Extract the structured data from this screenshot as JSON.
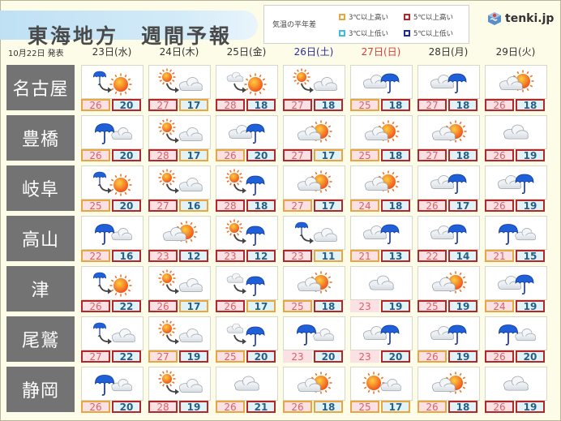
{
  "header": {
    "title": "東海地方　週間予報",
    "issued": "10月22日 発表",
    "logo_text": "tenki.jp"
  },
  "legend": {
    "title": "気温の平年差",
    "items": [
      {
        "label": "3℃以上高い",
        "color": "#e8a640"
      },
      {
        "label": "5℃以上高い",
        "color": "#b3262a"
      },
      {
        "label": "3℃以上低い",
        "color": "#3fbde0"
      },
      {
        "label": "5℃以上低い",
        "color": "#1c2a9c"
      }
    ]
  },
  "days": [
    {
      "label": "23日(水)",
      "type": "weekday"
    },
    {
      "label": "24日(木)",
      "type": "weekday"
    },
    {
      "label": "25日(金)",
      "type": "weekday"
    },
    {
      "label": "26日(土)",
      "type": "sat"
    },
    {
      "label": "27日(日)",
      "type": "sun"
    },
    {
      "label": "28日(月)",
      "type": "weekday"
    },
    {
      "label": "29日(火)",
      "type": "weekday"
    }
  ],
  "colors": {
    "high_3": "#e8a640",
    "high_5": "#b3262a",
    "low_3": "#3fbde0",
    "low_5": "#1c2a9c"
  },
  "cities": [
    {
      "name": "名古屋",
      "forecasts": [
        {
          "weather": "rain>sun",
          "hi": "26",
          "lo": "20",
          "hi_dev": "o",
          "lo_dev": "r"
        },
        {
          "weather": "sun>cloud",
          "hi": "27",
          "lo": "17",
          "hi_dev": "r",
          "lo_dev": "o"
        },
        {
          "weather": "cloud>sun",
          "hi": "28",
          "lo": "18",
          "hi_dev": "r",
          "lo_dev": "r"
        },
        {
          "weather": "sun>cloud",
          "hi": "27",
          "lo": "18",
          "hi_dev": "r",
          "lo_dev": "r"
        },
        {
          "weather": "cloud|rain",
          "hi": "25",
          "lo": "18",
          "hi_dev": "o",
          "lo_dev": "r"
        },
        {
          "weather": "cloud|rain",
          "hi": "27",
          "lo": "18",
          "hi_dev": "r",
          "lo_dev": "r"
        },
        {
          "weather": "cloud|sun",
          "hi": "26",
          "lo": "18",
          "hi_dev": "r",
          "lo_dev": "r"
        }
      ]
    },
    {
      "name": "豊橋",
      "forecasts": [
        {
          "weather": "rain|cloud",
          "hi": "26",
          "lo": "20",
          "hi_dev": "o",
          "lo_dev": "r"
        },
        {
          "weather": "sun>cloud",
          "hi": "28",
          "lo": "17",
          "hi_dev": "r",
          "lo_dev": "o"
        },
        {
          "weather": "cloud|rain",
          "hi": "26",
          "lo": "20",
          "hi_dev": "o",
          "lo_dev": "r"
        },
        {
          "weather": "cloud|sun",
          "hi": "27",
          "lo": "17",
          "hi_dev": "r",
          "lo_dev": "o"
        },
        {
          "weather": "cloud|sun",
          "hi": "25",
          "lo": "18",
          "hi_dev": "o",
          "lo_dev": "r"
        },
        {
          "weather": "cloud|sun",
          "hi": "27",
          "lo": "18",
          "hi_dev": "r",
          "lo_dev": "r"
        },
        {
          "weather": "cloud",
          "hi": "26",
          "lo": "19",
          "hi_dev": "r",
          "lo_dev": "r"
        }
      ]
    },
    {
      "name": "岐阜",
      "forecasts": [
        {
          "weather": "rain>sun",
          "hi": "25",
          "lo": "20",
          "hi_dev": "o",
          "lo_dev": "r"
        },
        {
          "weather": "sun>cloud",
          "hi": "27",
          "lo": "16",
          "hi_dev": "r",
          "lo_dev": "o"
        },
        {
          "weather": "sun>rain",
          "hi": "28",
          "lo": "18",
          "hi_dev": "r",
          "lo_dev": "r"
        },
        {
          "weather": "cloud|sun",
          "hi": "27",
          "lo": "17",
          "hi_dev": "o",
          "lo_dev": "r"
        },
        {
          "weather": "cloud|sun",
          "hi": "24",
          "lo": "18",
          "hi_dev": "o",
          "lo_dev": "r"
        },
        {
          "weather": "cloud|rain",
          "hi": "26",
          "lo": "17",
          "hi_dev": "r",
          "lo_dev": "r"
        },
        {
          "weather": "cloud|rain",
          "hi": "26",
          "lo": "19",
          "hi_dev": "r",
          "lo_dev": "r"
        }
      ]
    },
    {
      "name": "高山",
      "forecasts": [
        {
          "weather": "rain|cloud",
          "hi": "22",
          "lo": "16",
          "hi_dev": "o",
          "lo_dev": "r"
        },
        {
          "weather": "cloud|sun",
          "hi": "23",
          "lo": "12",
          "hi_dev": "r",
          "lo_dev": "r"
        },
        {
          "weather": "sun>rain",
          "hi": "23",
          "lo": "12",
          "hi_dev": "r",
          "lo_dev": "r"
        },
        {
          "weather": "rain>cloud",
          "hi": "23",
          "lo": "11",
          "hi_dev": "r",
          "lo_dev": "o"
        },
        {
          "weather": "cloud|rain",
          "hi": "21",
          "lo": "13",
          "hi_dev": "o",
          "lo_dev": "r"
        },
        {
          "weather": "cloud|rain",
          "hi": "22",
          "lo": "14",
          "hi_dev": "r",
          "lo_dev": "r"
        },
        {
          "weather": "rain|cloud",
          "hi": "21",
          "lo": "15",
          "hi_dev": "o",
          "lo_dev": "r"
        }
      ]
    },
    {
      "name": "津",
      "forecasts": [
        {
          "weather": "rain>sun",
          "hi": "26",
          "lo": "22",
          "hi_dev": "r",
          "lo_dev": "r"
        },
        {
          "weather": "sun>cloud",
          "hi": "26",
          "lo": "17",
          "hi_dev": "r",
          "lo_dev": "o"
        },
        {
          "weather": "cloud>rain",
          "hi": "26",
          "lo": "17",
          "hi_dev": "r",
          "lo_dev": "o"
        },
        {
          "weather": "cloud|sun",
          "hi": "25",
          "lo": "18",
          "hi_dev": "o",
          "lo_dev": "r"
        },
        {
          "weather": "cloud",
          "hi": "23",
          "lo": "19",
          "hi_dev": "n",
          "lo_dev": "r"
        },
        {
          "weather": "cloud|sun",
          "hi": "25",
          "lo": "19",
          "hi_dev": "r",
          "lo_dev": "r"
        },
        {
          "weather": "cloud|rain",
          "hi": "24",
          "lo": "19",
          "hi_dev": "o",
          "lo_dev": "r"
        }
      ]
    },
    {
      "name": "尾鷲",
      "forecasts": [
        {
          "weather": "rain>cloud",
          "hi": "27",
          "lo": "22",
          "hi_dev": "r",
          "lo_dev": "r"
        },
        {
          "weather": "sun>cloud",
          "hi": "27",
          "lo": "19",
          "hi_dev": "o",
          "lo_dev": "r"
        },
        {
          "weather": "cloud>rain",
          "hi": "25",
          "lo": "20",
          "hi_dev": "o",
          "lo_dev": "r"
        },
        {
          "weather": "rain|cloud",
          "hi": "23",
          "lo": "20",
          "hi_dev": "n",
          "lo_dev": "r"
        },
        {
          "weather": "cloud|rain",
          "hi": "23",
          "lo": "20",
          "hi_dev": "n",
          "lo_dev": "r"
        },
        {
          "weather": "cloud|rain",
          "hi": "26",
          "lo": "19",
          "hi_dev": "o",
          "lo_dev": "r"
        },
        {
          "weather": "rain|cloud",
          "hi": "26",
          "lo": "20",
          "hi_dev": "r",
          "lo_dev": "r"
        }
      ]
    },
    {
      "name": "静岡",
      "forecasts": [
        {
          "weather": "rain|cloud",
          "hi": "26",
          "lo": "20",
          "hi_dev": "o",
          "lo_dev": "r"
        },
        {
          "weather": "sun>cloud",
          "hi": "28",
          "lo": "19",
          "hi_dev": "r",
          "lo_dev": "r"
        },
        {
          "weather": "cloud",
          "hi": "26",
          "lo": "21",
          "hi_dev": "o",
          "lo_dev": "r"
        },
        {
          "weather": "cloud|sun",
          "hi": "26",
          "lo": "18",
          "hi_dev": "o",
          "lo_dev": "o"
        },
        {
          "weather": "sun|cloud",
          "hi": "25",
          "lo": "17",
          "hi_dev": "o",
          "lo_dev": "o"
        },
        {
          "weather": "cloud|sun",
          "hi": "26",
          "lo": "18",
          "hi_dev": "o",
          "lo_dev": "r"
        },
        {
          "weather": "cloud",
          "hi": "26",
          "lo": "19",
          "hi_dev": "r",
          "lo_dev": "r"
        }
      ]
    }
  ]
}
